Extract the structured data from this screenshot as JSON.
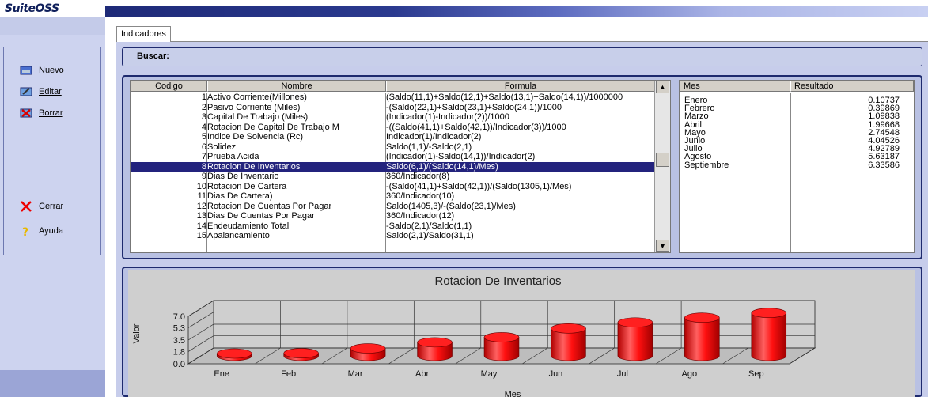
{
  "app": {
    "logo": "SuiteOSS"
  },
  "sidebar": {
    "buttons": [
      {
        "label": "Nuevo",
        "icon": "new-icon"
      },
      {
        "label": "Editar",
        "icon": "edit-icon"
      },
      {
        "label": "Borrar",
        "icon": "delete-icon"
      }
    ],
    "bottom_buttons": [
      {
        "label": "Cerrar",
        "icon": "close-icon"
      },
      {
        "label": "Ayuda",
        "icon": "help-icon"
      }
    ]
  },
  "tab": {
    "label": "Indicadores"
  },
  "search": {
    "label": "Buscar:"
  },
  "table": {
    "columns": [
      "Codigo",
      "Nombre",
      "Formula"
    ],
    "selected_index": 7,
    "rows": [
      {
        "code": "1",
        "name": "Activo Corriente(Millones)",
        "formula": "(Saldo(11,1)+Saldo(12,1)+Saldo(13,1)+Saldo(14,1))/1000000"
      },
      {
        "code": "2",
        "name": "Pasivo Corriente (Miles)",
        "formula": "-(Saldo(22,1)+Saldo(23,1)+Saldo(24,1))/1000"
      },
      {
        "code": "3",
        "name": "Capital De Trabajo (Miles)",
        "formula": "(Indicador(1)-Indicador(2))/1000"
      },
      {
        "code": "4",
        "name": "Rotacion De Capital De Trabajo M",
        "formula": "-((Saldo(41,1)+Saldo(42,1))/Indicador(3))/1000"
      },
      {
        "code": "5",
        "name": "Indice De Solvencia (Rc)",
        "formula": "Indicador(1)/Indicador(2)"
      },
      {
        "code": "6",
        "name": "Solidez",
        "formula": "Saldo(1,1)/-Saldo(2,1)"
      },
      {
        "code": "7",
        "name": "Prueba Acida",
        "formula": "(Indicador(1)-Saldo(14,1))/Indicador(2)"
      },
      {
        "code": "8",
        "name": "Rotacion De Inventarios",
        "formula": "Saldo(6,1)/(Saldo(14,1)/Mes)"
      },
      {
        "code": "9",
        "name": "Dias De Inventario",
        "formula": "360/Indicador(8)"
      },
      {
        "code": "10",
        "name": "Rotacion De Cartera",
        "formula": "-(Saldo(41,1)+Saldo(42,1))/(Saldo(1305,1)/Mes)"
      },
      {
        "code": "11",
        "name": "Dias De Cartera)",
        "formula": "360/Indicador(10)"
      },
      {
        "code": "12",
        "name": "Rotacion De Cuentas Por Pagar",
        "formula": "Saldo(1405,3)/-(Saldo(23,1)/Mes)"
      },
      {
        "code": "13",
        "name": "Dias De Cuentas Por Pagar",
        "formula": "360/Indicador(12)"
      },
      {
        "code": "14",
        "name": "Endeudamiento Total",
        "formula": "-Saldo(2,1)/Saldo(1,1)"
      },
      {
        "code": "15",
        "name": "Apalancamiento",
        "formula": "Saldo(2,1)/Saldo(31,1)"
      }
    ]
  },
  "results": {
    "columns": [
      "Mes",
      "Resultado"
    ],
    "rows": [
      {
        "mes": "Enero",
        "resultado": "0.10737"
      },
      {
        "mes": "Febrero",
        "resultado": "0.39869"
      },
      {
        "mes": "Marzo",
        "resultado": "1.09838"
      },
      {
        "mes": "Abril",
        "resultado": "1.99668"
      },
      {
        "mes": "Mayo",
        "resultado": "2.74548"
      },
      {
        "mes": "Junio",
        "resultado": "4.04526"
      },
      {
        "mes": "Julio",
        "resultado": "4.92789"
      },
      {
        "mes": "Agosto",
        "resultado": "5.63187"
      },
      {
        "mes": "Septiembre",
        "resultado": "6.33586"
      }
    ]
  },
  "chart_data": {
    "type": "bar",
    "title": "Rotacion De Inventarios",
    "xlabel": "Mes",
    "ylabel": "Valor",
    "categories": [
      "Ene",
      "Feb",
      "Mar",
      "Abr",
      "May",
      "Jun",
      "Jul",
      "Ago",
      "Sep"
    ],
    "values": [
      0.10737,
      0.39869,
      1.09838,
      1.99668,
      2.74548,
      4.04526,
      4.92789,
      5.63187,
      6.33586
    ],
    "yticks": [
      "0.0",
      "1.8",
      "3.5",
      "5.3",
      "7.0"
    ],
    "ylim": [
      0,
      7.0
    ],
    "bar_color": "#ff0000",
    "grid": true
  }
}
